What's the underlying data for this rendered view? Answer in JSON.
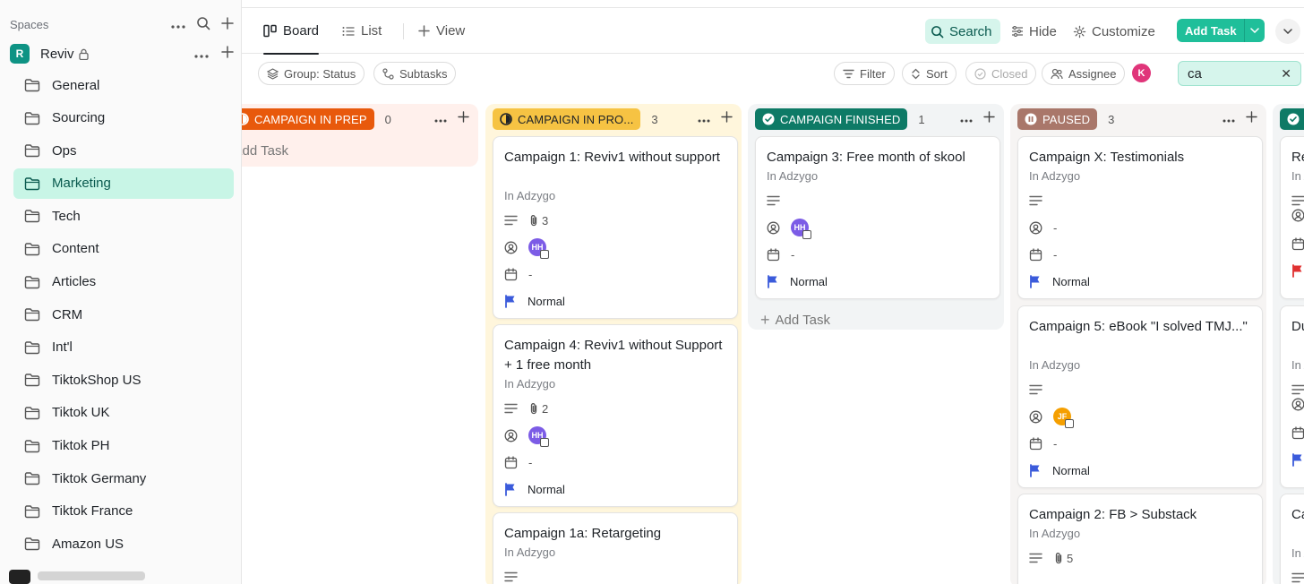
{
  "sidebar": {
    "header": "Spaces",
    "space": {
      "badge": "R",
      "name": "Reviv"
    },
    "folders": [
      {
        "label": "General"
      },
      {
        "label": "Sourcing"
      },
      {
        "label": "Ops"
      },
      {
        "label": "Marketing",
        "active": true
      },
      {
        "label": "Tech"
      },
      {
        "label": "Content"
      },
      {
        "label": "Articles"
      },
      {
        "label": "CRM"
      },
      {
        "label": "Int'l"
      },
      {
        "label": "TiktokShop US"
      },
      {
        "label": "Tiktok UK"
      },
      {
        "label": "Tiktok PH"
      },
      {
        "label": "Tiktok Germany"
      },
      {
        "label": "Tiktok France"
      },
      {
        "label": "Amazon US"
      }
    ]
  },
  "topbar": {
    "tabs": {
      "board": "Board",
      "list": "List",
      "view": "View"
    },
    "search": "Search",
    "hide": "Hide",
    "customize": "Customize",
    "add_task": "Add Task"
  },
  "filterbar": {
    "group": "Group: Status",
    "subtasks": "Subtasks",
    "filter": "Filter",
    "sort": "Sort",
    "closed": "Closed",
    "assignee": "Assignee",
    "avatar": "K",
    "search_value": "ca",
    "clear": "✕"
  },
  "colors": {
    "accent": "#1fbf9a",
    "prep": "#e8590c",
    "in_progress": "#f6c343",
    "finished": "#0e7a66",
    "paused": "#a9776a",
    "flag_blue": "#3b5bdb",
    "flag_red": "#e03131",
    "avatar_hh": "#7c5ce6",
    "avatar_jf": "#f59f00"
  },
  "board": {
    "add_task": "Add Task",
    "empty_value": "-",
    "columns": [
      {
        "status": "CAMPAIGN IN PREP",
        "count": "0"
      },
      {
        "status": "CAMPAIGN IN PRO...",
        "count": "3",
        "cards": [
          {
            "title": "Campaign 1: Reviv1 without support",
            "location": "In Adzygo",
            "attachments": "3",
            "assignee": "HH",
            "due": "-",
            "priority": "Normal"
          },
          {
            "title": "Campaign 4: Reviv1 without Support + 1 free month",
            "location": "In Adzygo",
            "attachments": "2",
            "assignee": "HH",
            "due": "-",
            "priority": "Normal"
          },
          {
            "title": "Campaign 1a: Retargeting",
            "location": "In Adzygo"
          }
        ]
      },
      {
        "status": "CAMPAIGN FINISHED",
        "count": "1",
        "cards": [
          {
            "title": "Campaign 3: Free month of skool",
            "location": "In Adzygo",
            "assignee": "HH",
            "due": "-",
            "priority": "Normal"
          }
        ]
      },
      {
        "status": "PAUSED",
        "count": "3",
        "cards": [
          {
            "title": "Campaign X: Testimonials",
            "location": "In Adzygo",
            "assignee": "-",
            "due": "-",
            "priority": "Normal"
          },
          {
            "title": "Campaign 5: eBook \"I solved TMJ...\"",
            "location": "In Adzygo",
            "assignee": "JF",
            "due": "-",
            "priority": "Normal"
          },
          {
            "title": "Campaign 2: FB > Substack",
            "location": "In Adzygo",
            "attachments": "5"
          }
        ]
      },
      {
        "status": "",
        "cards": [
          {
            "title": "Re",
            "location": "In A"
          },
          {
            "title": "Du Co",
            "location": "In A"
          },
          {
            "title": "Ca Su",
            "location": "In A"
          }
        ]
      }
    ]
  }
}
